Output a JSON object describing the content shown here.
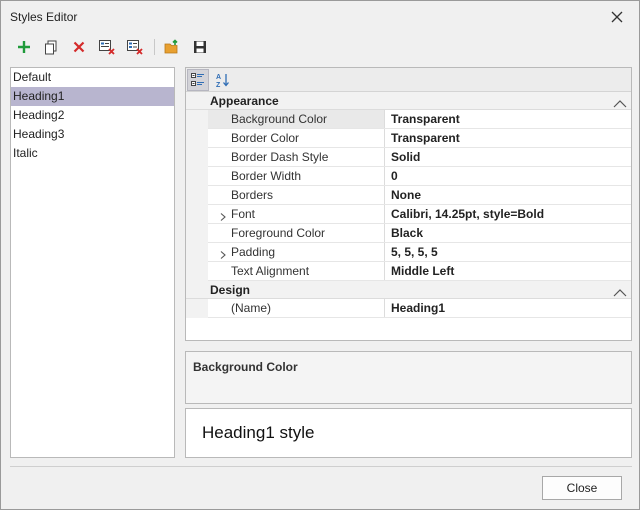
{
  "window": {
    "title": "Styles Editor"
  },
  "toolbar": {
    "icons": [
      "add-style-icon",
      "duplicate-style-icon",
      "delete-style-icon",
      "clear-style-icon",
      "clear-all-styles-icon",
      "load-styles-icon",
      "save-styles-icon"
    ]
  },
  "styles": {
    "items": [
      "Default",
      "Heading1",
      "Heading2",
      "Heading3",
      "Italic"
    ],
    "selected": "Heading1"
  },
  "property_grid": {
    "categories": [
      {
        "name": "Appearance",
        "properties": [
          {
            "name": "Background Color",
            "value": "Transparent",
            "expandable": false
          },
          {
            "name": "Border Color",
            "value": "Transparent",
            "expandable": false
          },
          {
            "name": "Border Dash Style",
            "value": "Solid",
            "expandable": false
          },
          {
            "name": "Border Width",
            "value": "0",
            "expandable": false
          },
          {
            "name": "Borders",
            "value": "None",
            "expandable": false
          },
          {
            "name": "Font",
            "value": "Calibri, 14.25pt, style=Bold",
            "expandable": true
          },
          {
            "name": "Foreground Color",
            "value": "Black",
            "expandable": false
          },
          {
            "name": "Padding",
            "value": "5, 5, 5, 5",
            "expandable": true
          },
          {
            "name": "Text Alignment",
            "value": "Middle Left",
            "expandable": false
          }
        ]
      },
      {
        "name": "Design",
        "properties": [
          {
            "name": "(Name)",
            "value": "Heading1",
            "expandable": false
          }
        ]
      }
    ],
    "selected_property": "Background Color"
  },
  "description": {
    "title": "Background Color"
  },
  "preview": {
    "text": "Heading1 style"
  },
  "footer": {
    "close_label": "Close"
  },
  "colors": {
    "selection": "#b8b5cf",
    "add_icon": "#1f9a3a",
    "delete_icon": "#d42a2a",
    "accent_blue": "#2f6db5",
    "folder_icon": "#e8a030"
  }
}
